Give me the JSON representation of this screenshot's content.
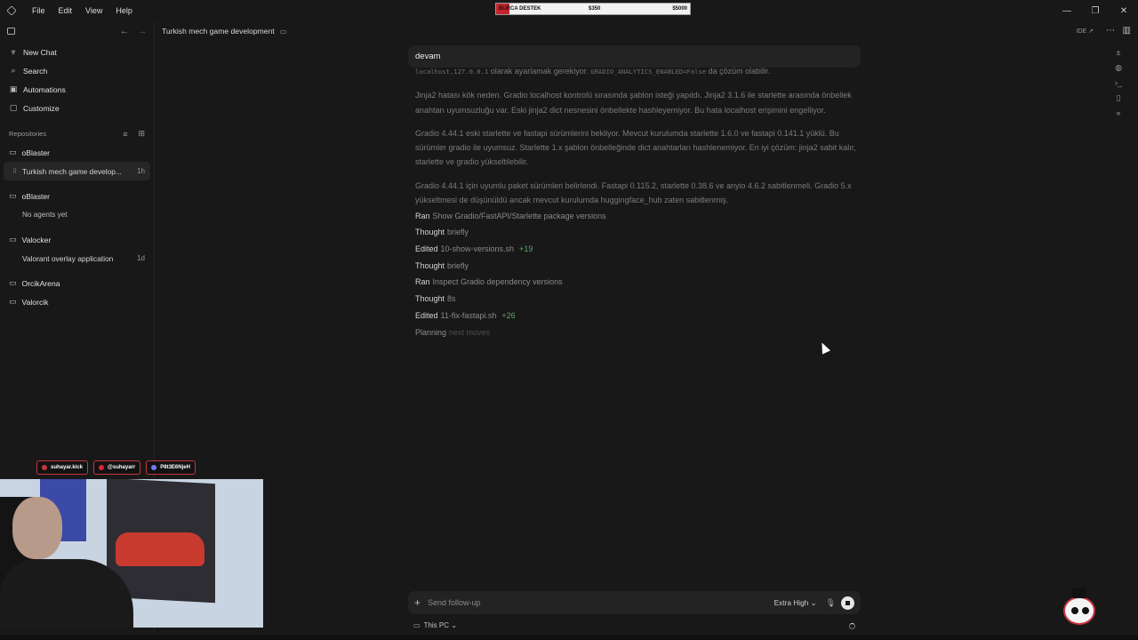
{
  "menu": [
    "File",
    "Edit",
    "View",
    "Help"
  ],
  "donation": {
    "label": "BURCA DESTEK",
    "current": "$350",
    "goal": "$5000",
    "progress": 0.07
  },
  "window_controls": [
    "minimize-icon",
    "restore-icon",
    "close-icon"
  ],
  "sidebar": {
    "nav": [
      {
        "label": "New Chat",
        "icon": "filter-icon"
      },
      {
        "label": "Search",
        "icon": "search-icon"
      },
      {
        "label": "Automations",
        "icon": "calendar-icon"
      },
      {
        "label": "Customize",
        "icon": "box-icon"
      }
    ],
    "repositories_label": "Repositories",
    "groups": [
      {
        "name": "oBlaster",
        "threads": [
          {
            "title": "Turkish mech game develop...",
            "age": "1h",
            "active": true
          }
        ]
      },
      {
        "name": "oBlaster",
        "empty": "No agents yet"
      },
      {
        "name": "Valocker",
        "threads": [
          {
            "title": "Valorant overlay application",
            "age": "1d"
          }
        ]
      },
      {
        "name": "OrcikArena"
      },
      {
        "name": "Valorcik"
      }
    ]
  },
  "header": {
    "title": "Turkish mech game development",
    "ide_label": "IDE ↗"
  },
  "user_message": "devam",
  "assistant": {
    "cut_line_prefix": "localhost,127.0.0.1",
    "cut_line_mid": " olarak ayarlamak gerekiyor. ",
    "cut_line_code": "GRADIO_ANALYTICS_ENABLED=False",
    "cut_line_suffix": " da çözüm olabilir.",
    "paragraphs": [
      "Jinja2 hatası kök neden. Gradio localhost kontrolü sırasında şablon isteği yapıldı. Jinja2 3.1.6 ile starlette arasında önbellek anahtarı uyumsuzluğu var. Eski jinja2 dict nesnesini önbellekte hashleyemiyor. Bu hata localhost erişimini engelliyor.",
      "Gradio 4.44.1 eski starlette ve fastapi sürümlerini bekliyor. Mevcut kurulumda starlette 1.6.0 ve fastapi 0.141.1 yüklü. Bu sürümler gradio ile uyumsuz. Starlette 1.x şablon önbelleğinde dict anahtarları hashlenemiyor. En iyi çözüm: jinja2 sabit kalır, starlette ve gradio yükseltilebilir.",
      "Gradio 4.44.1 için uyumlu paket sürümleri belirlendi. Fastapi 0.115.2, starlette 0.38.6 ve anyio 4.6.2 sabitlenmeli. Gradio 5.x yükseltmesi de düşünüldü ancak mevcut kurulumda huggingface_hub zaten sabitlenmiş."
    ],
    "steps": [
      {
        "verb": "Ran",
        "rest": "Show Gradio/FastAPI/Starlette package versions",
        "add": ""
      },
      {
        "verb": "Thought",
        "rest": "briefly",
        "add": ""
      },
      {
        "verb": "Edited",
        "rest": "10-show-versions.sh",
        "add": "+19"
      },
      {
        "verb": "Thought",
        "rest": "briefly",
        "add": ""
      },
      {
        "verb": "Ran",
        "rest": "Inspect Gradio dependency versions",
        "add": ""
      },
      {
        "verb": "Thought",
        "rest": "8s",
        "add": ""
      },
      {
        "verb": "Edited",
        "rest": "11-fix-fastapi.sh",
        "add": "+26"
      }
    ],
    "planning": {
      "verb": "Planning",
      "rest": "next moves"
    }
  },
  "composer": {
    "placeholder": "Send follow-up",
    "effort": "Extra High ⌄",
    "location": "This PC ⌄"
  },
  "overlay": {
    "socials": [
      {
        "handle": "suhayar.kick",
        "color": "#c7373f"
      },
      {
        "handle": "@suhayarr",
        "color": "#e0242f"
      },
      {
        "handle": "P8t3E6NjeH",
        "color": "#6f7cf0"
      }
    ]
  },
  "colors": {
    "accent_add": "#5fa36a",
    "stream_red": "#c7373f"
  }
}
